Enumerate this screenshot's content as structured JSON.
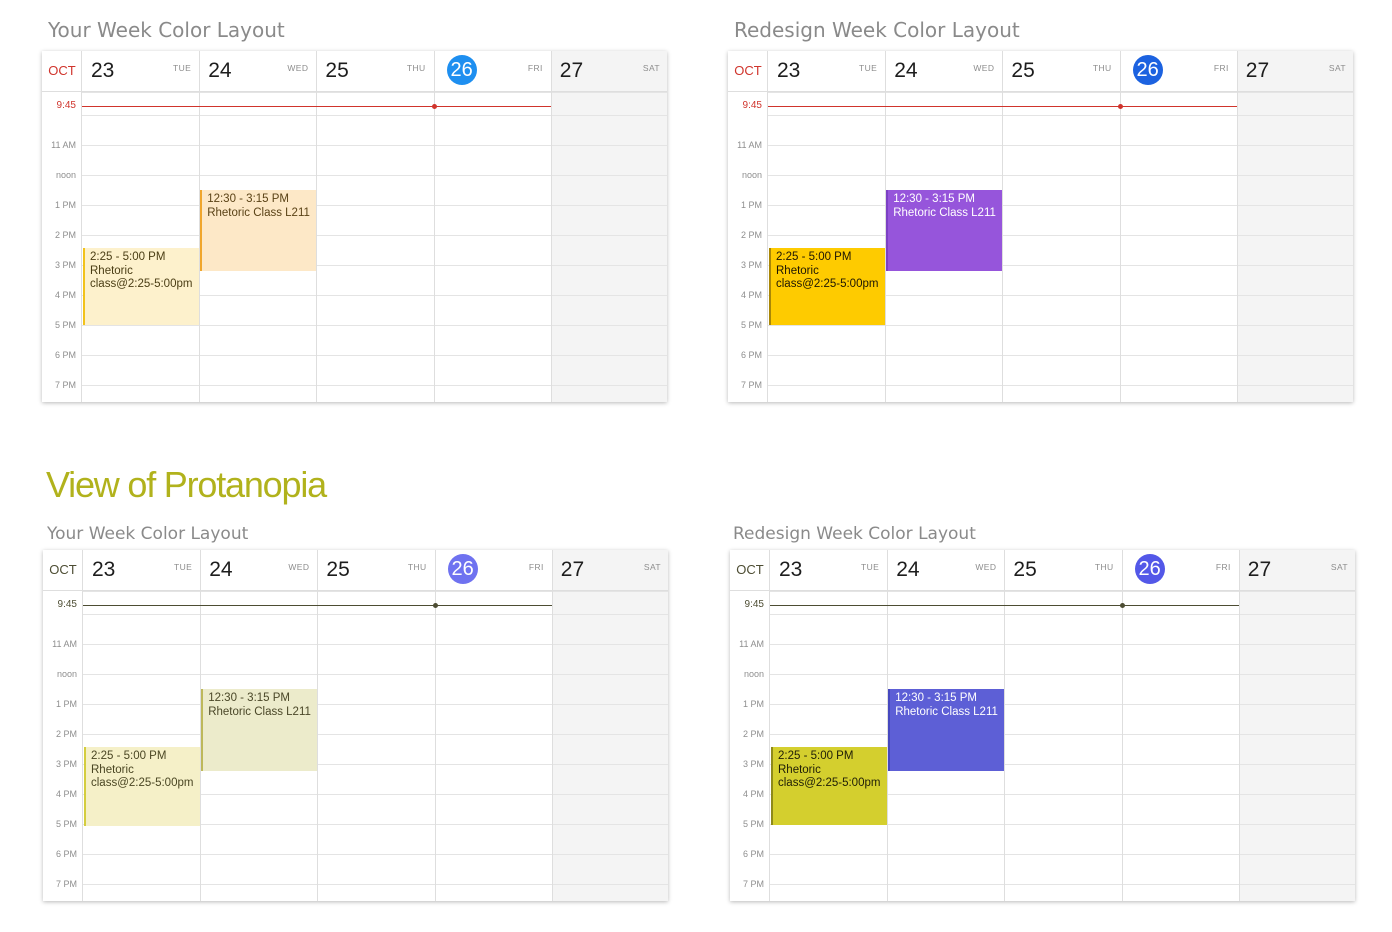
{
  "top_left_label": "Your Week Color Layout",
  "top_right_label": "Redesign Week Color Layout",
  "section_title": "View of Protanopia",
  "bottom_left_label": "Your Week Color Layout",
  "bottom_right_label": "Redesign Week Color Layout",
  "colors": {
    "section_title": "#b1b21c",
    "now_red": "#d0342c",
    "now_protan": "#4d4d33",
    "today_blue": "#1e8ff0",
    "today_blue_redesign": "#1c62e0",
    "today_protan": "#6f72f0",
    "today_protan_redesign": "#5358e8"
  },
  "calendar": {
    "month": "OCT",
    "days": [
      {
        "num": "23",
        "name": "TUE"
      },
      {
        "num": "24",
        "name": "WED"
      },
      {
        "num": "25",
        "name": "THU"
      },
      {
        "num": "26",
        "name": "FRI"
      },
      {
        "num": "27",
        "name": "SAT"
      }
    ],
    "now_time": "9:45",
    "hours": [
      "11 AM",
      "noon",
      "1 PM",
      "2 PM",
      "3 PM",
      "4 PM",
      "5 PM",
      "6 PM",
      "7 PM"
    ],
    "events": [
      {
        "time": "2:25 - 5:00 PM",
        "name": "Rhetoric",
        "name2": "class@2:25-5:00pm"
      },
      {
        "time": "12:30 - 3:15 PM",
        "name": "Rhetoric Class L211"
      }
    ]
  }
}
